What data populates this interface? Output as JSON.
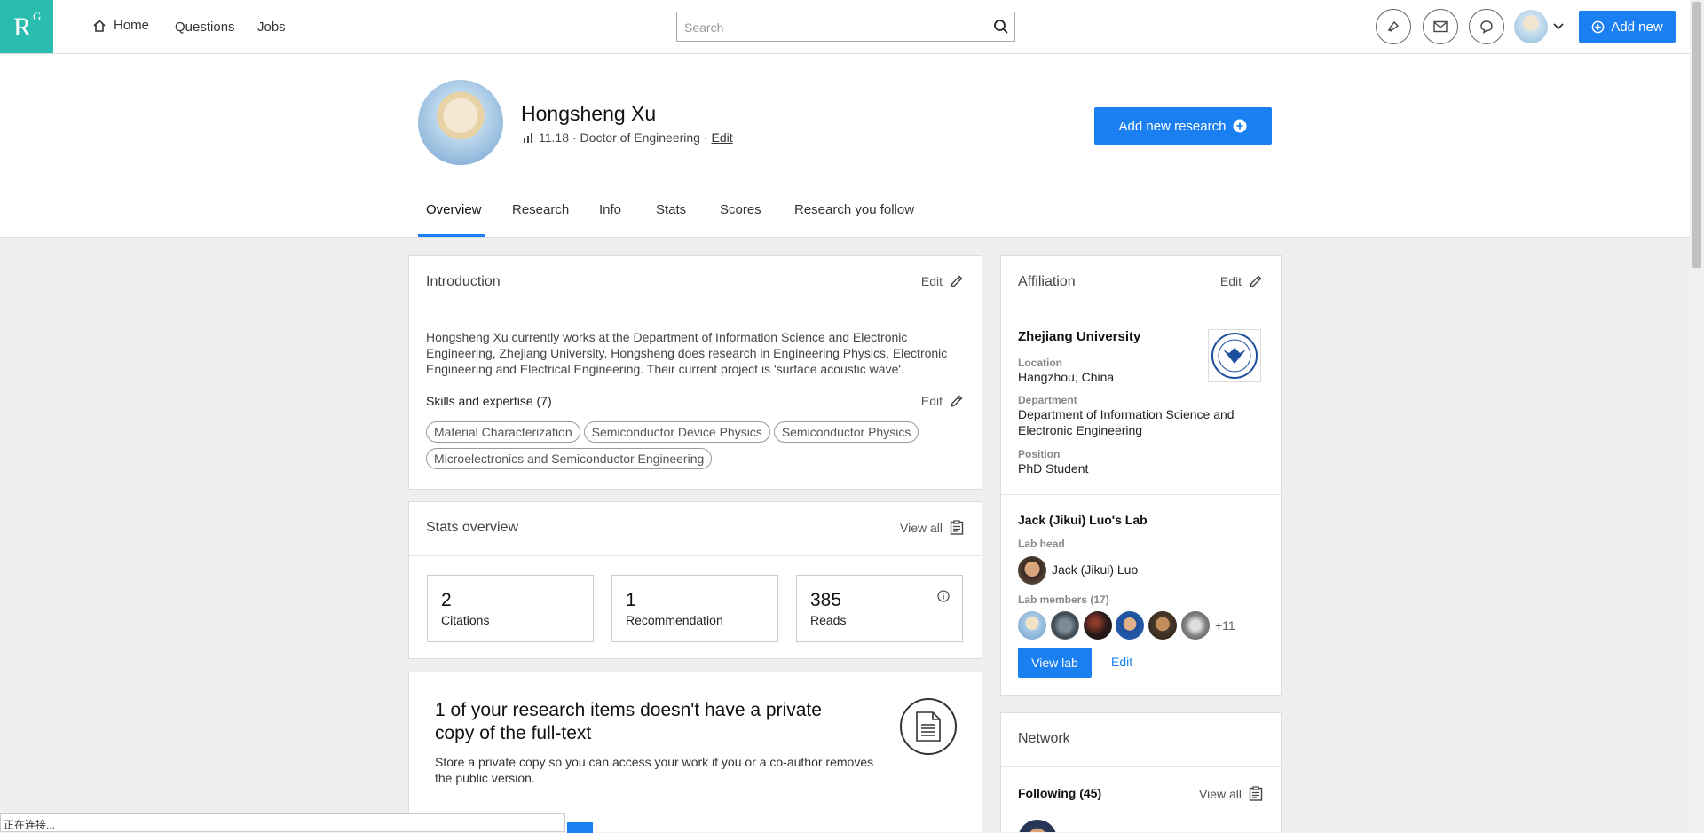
{
  "nav": {
    "logo_r": "R",
    "logo_g": "G",
    "home": "Home",
    "questions": "Questions",
    "jobs": "Jobs",
    "search_placeholder": "Search",
    "add_new": "Add new"
  },
  "profile": {
    "name": "Hongsheng Xu",
    "score": "11.18",
    "degree": "· Doctor of Engineering ·",
    "edit": "Edit",
    "add_research": "Add new research"
  },
  "tabs": [
    "Overview",
    "Research",
    "Info",
    "Stats",
    "Scores",
    "Research you follow"
  ],
  "introduction": {
    "title": "Introduction",
    "edit": "Edit",
    "text": "Hongsheng Xu currently works at the Department of Information Science and Electronic Engineering, Zhejiang University. Hongsheng does research in Engineering Physics, Electronic Engineering and Electrical Engineering. Their current project is 'surface acoustic wave'.",
    "skills_title": "Skills and expertise (7)",
    "skills_edit": "Edit",
    "skills": [
      "Material Characterization",
      "Semiconductor Device Physics",
      "Semiconductor Physics",
      "Microelectronics and Semiconductor Engineering"
    ]
  },
  "stats": {
    "title": "Stats overview",
    "view_all": "View all",
    "items": [
      {
        "num": "2",
        "label": "Citations"
      },
      {
        "num": "1",
        "label": "Recommendation"
      },
      {
        "num": "385",
        "label": "Reads"
      }
    ]
  },
  "fulltext": {
    "title": "1 of your research items doesn't have a private copy of the full-text",
    "desc": "Store a private copy so you can access your work if you or a co-author removes the public version."
  },
  "affiliation": {
    "title": "Affiliation",
    "edit": "Edit",
    "institution": "Zhejiang University",
    "location_label": "Location",
    "location": "Hangzhou, China",
    "department_label": "Department",
    "department": "Department of Information Science and Electronic Engineering",
    "position_label": "Position",
    "position": "PhD Student",
    "lab_title": "Jack (Jikui) Luo's Lab",
    "lab_head_label": "Lab head",
    "lab_head": "Jack (Jikui) Luo",
    "lab_members_label": "Lab members (17)",
    "more_members": "+11",
    "view_lab": "View lab",
    "lab_edit": "Edit"
  },
  "network": {
    "title": "Network",
    "following": "Following (45)",
    "view_all": "View all"
  },
  "status_bar": "正在连接...",
  "colors": {
    "accent": "#1a7ff0",
    "logo": "#2bbcb0"
  }
}
